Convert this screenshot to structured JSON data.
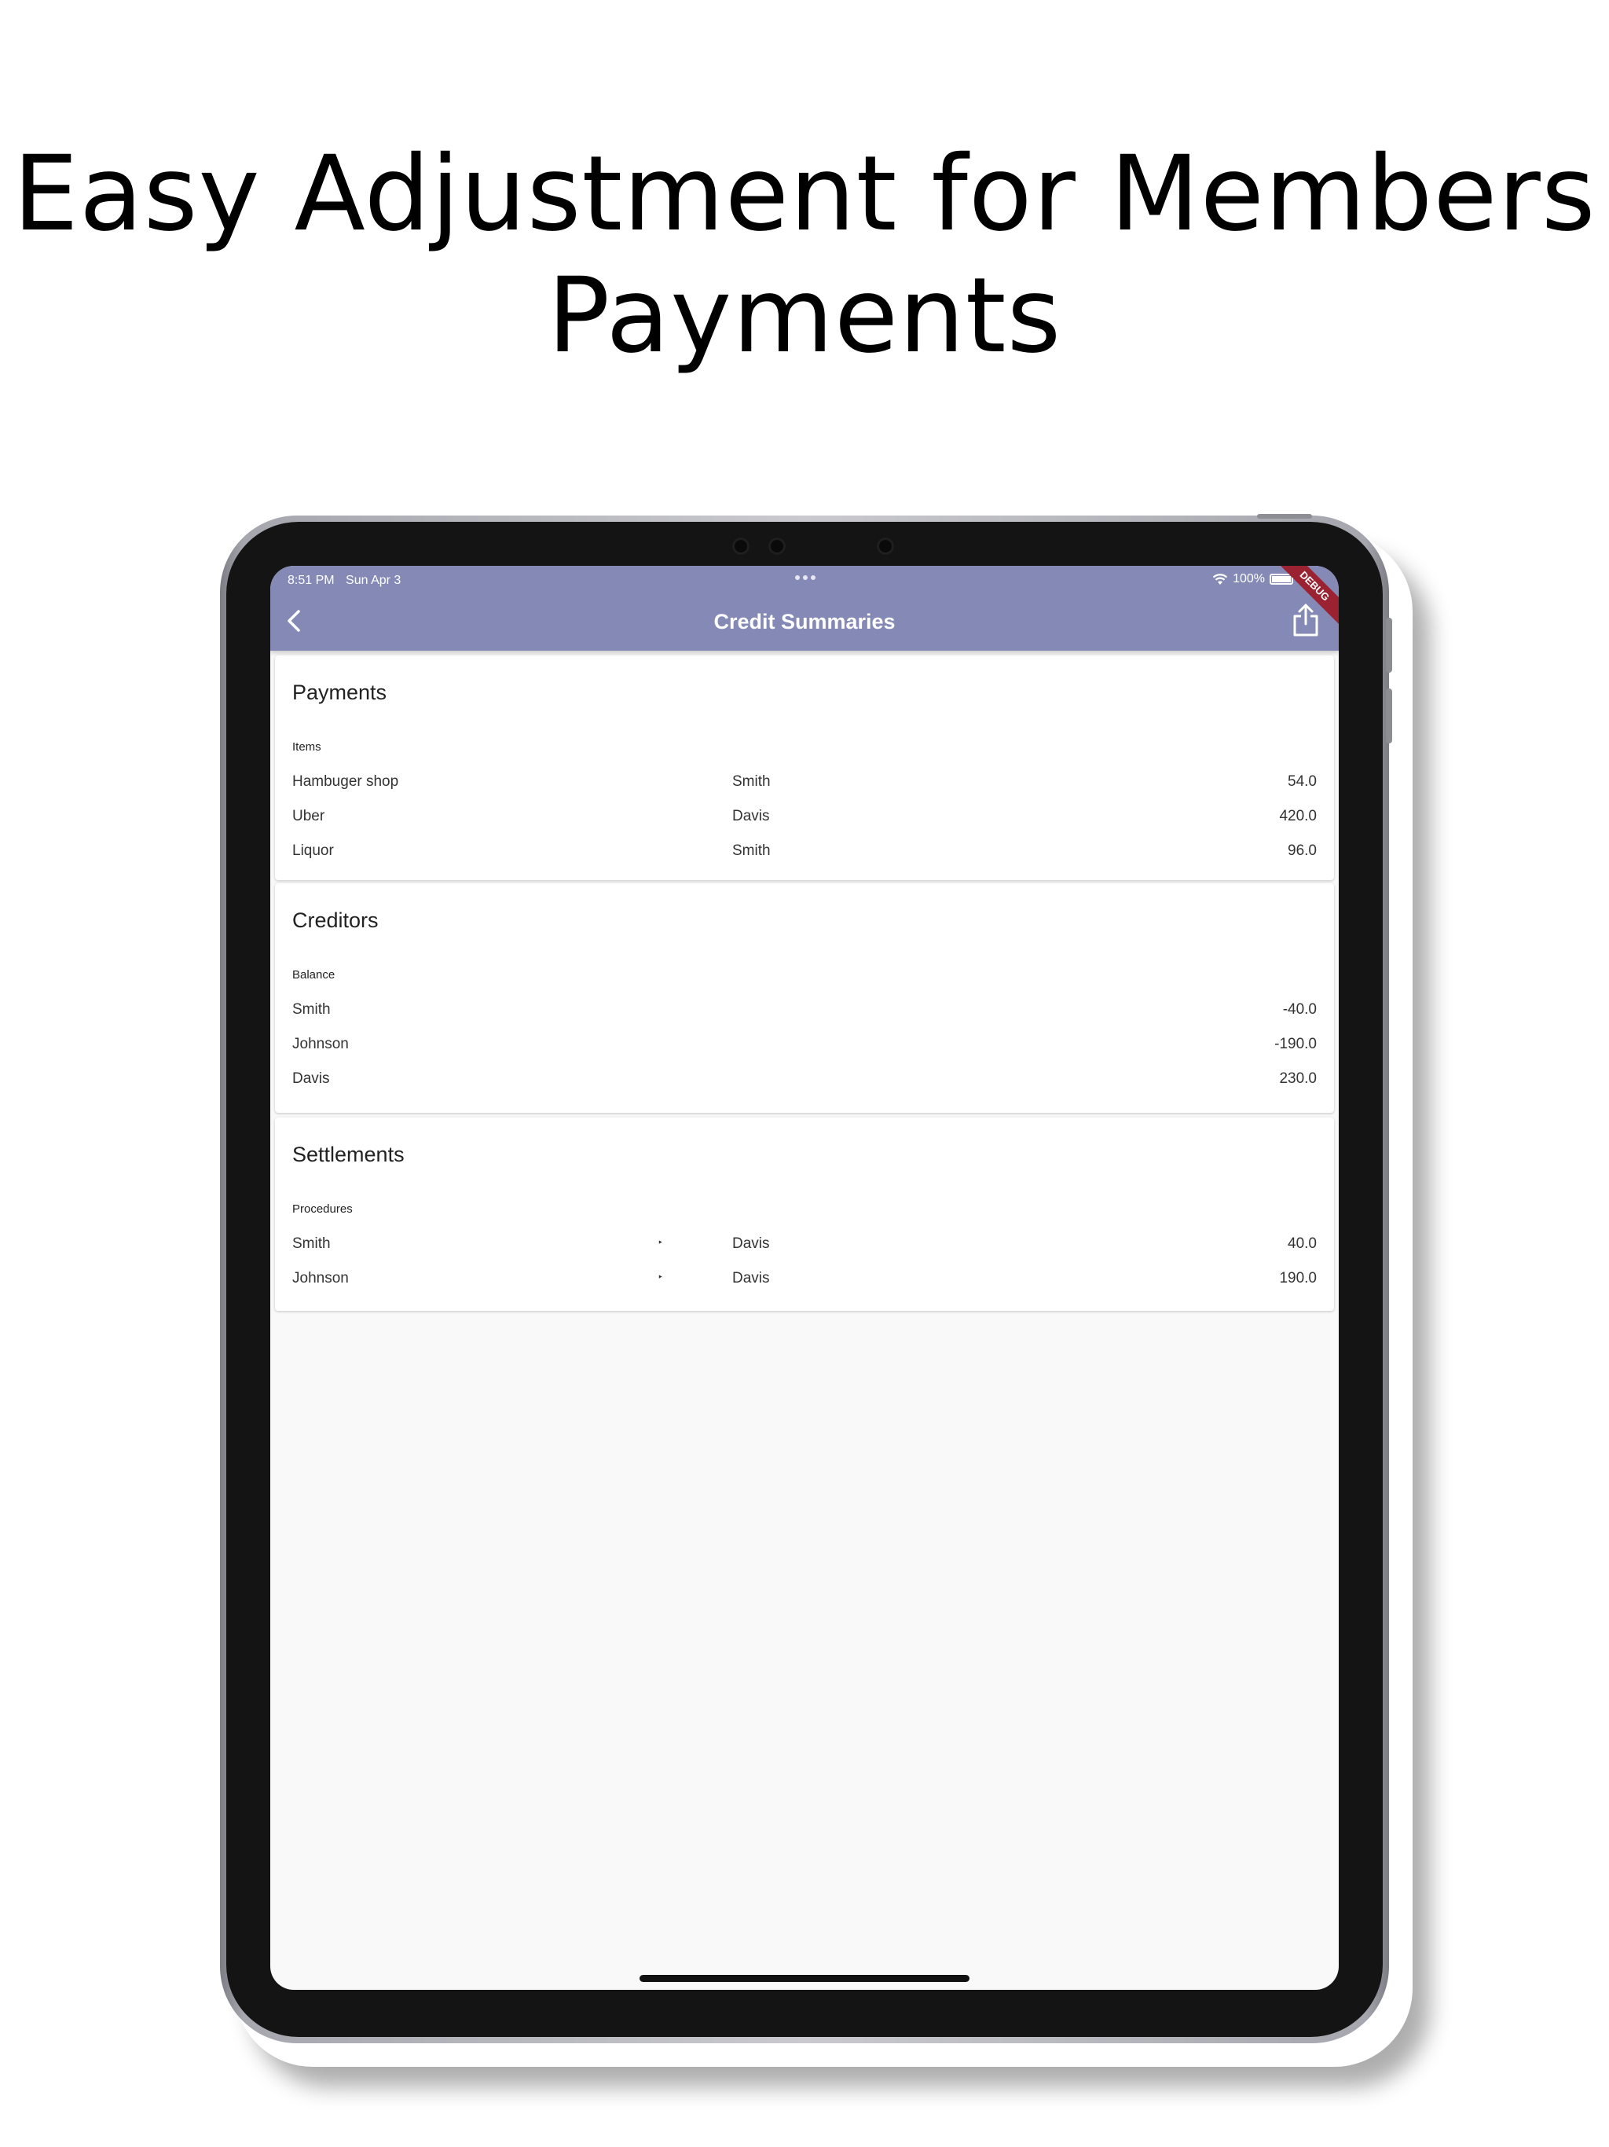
{
  "headline": {
    "line1": "Easy Adjustment for Members",
    "line2": "Payments"
  },
  "status_bar": {
    "time": "8:51 PM",
    "date": "Sun Apr 3",
    "battery": "100%",
    "debug_label": "DEBUG"
  },
  "appbar": {
    "title": "Credit Summaries",
    "color": "#8489b5"
  },
  "payments": {
    "title": "Payments",
    "subtitle": "Items",
    "rows": [
      {
        "item": "Hambuger shop",
        "member": "Smith",
        "amount": "54.0"
      },
      {
        "item": "Uber",
        "member": "Davis",
        "amount": "420.0"
      },
      {
        "item": "Liquor",
        "member": "Smith",
        "amount": "96.0"
      }
    ]
  },
  "creditors": {
    "title": "Creditors",
    "subtitle": "Balance",
    "rows": [
      {
        "member": "Smith",
        "balance": "-40.0"
      },
      {
        "member": "Johnson",
        "balance": "-190.0"
      },
      {
        "member": "Davis",
        "balance": "230.0"
      }
    ]
  },
  "settlements": {
    "title": "Settlements",
    "subtitle": "Procedures",
    "rows": [
      {
        "from": "Smith",
        "arrow": "‣",
        "to": "Davis",
        "amount": "40.0"
      },
      {
        "from": "Johnson",
        "arrow": "‣",
        "to": "Davis",
        "amount": "190.0"
      }
    ]
  }
}
